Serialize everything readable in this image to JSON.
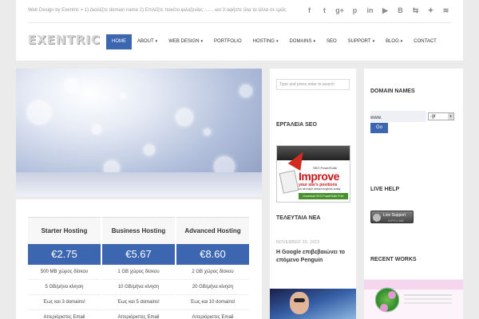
{
  "header": {
    "tagline": "Web Design by Exentric = 1) Διαλέξτε domain name 2) Επιλέξτε πακέτο φιλοξενίας ....... και 3 αφήστε όλα τα άλλα σε εμάς",
    "logo": "EXENTRIC",
    "social_icons": [
      "facebook-icon",
      "twitter-icon",
      "google-plus-icon",
      "pinterest-icon",
      "linkedin-icon",
      "youtube-icon",
      "blogger-icon",
      "share-icon",
      "delicious-icon",
      "rss-icon"
    ],
    "social_glyphs": [
      "f",
      "t",
      "g+",
      "p",
      "in",
      "▶",
      "B",
      "⇆",
      "✦",
      "≋"
    ]
  },
  "nav": {
    "items": [
      {
        "label": "HOME",
        "active": true,
        "has_caret": false
      },
      {
        "label": "ABOUT",
        "caret": "▾"
      },
      {
        "label": "WEB DESIGN",
        "caret": "▾"
      },
      {
        "label": "PORTFOLIO"
      },
      {
        "label": "HOSTING",
        "caret": "▾"
      },
      {
        "label": "DOMAINS",
        "caret": "▾"
      },
      {
        "label": "SEO"
      },
      {
        "label": "SUPPORT",
        "caret": "▾"
      },
      {
        "label": "BLOG",
        "caret": "▾"
      },
      {
        "label": "CONTACT"
      }
    ]
  },
  "pricing": {
    "plans": [
      {
        "name": "Starter Hosting",
        "price": "€2.75",
        "features": [
          "500 MB χώρος δίσκου",
          "5 GB/μήνα κίνηση",
          "Έως και 3 domains!",
          "Απεριόριστες Email"
        ]
      },
      {
        "name": "Business Hosting",
        "price": "€5.67",
        "features": [
          "1 GB χώρος δίσκου",
          "10 GB/μήνα κίνηση",
          "Έως και 5 domains!",
          "Απεριόριστες Email"
        ]
      },
      {
        "name": "Advanced Hosting",
        "price": "€8.60",
        "features": [
          "2 GB χώρος δίσκου",
          "20 GB/μήνα κίνηση",
          "Έως και 10 domains!",
          "Απεριόριστες Email"
        ]
      }
    ]
  },
  "middle": {
    "search_placeholder": "Type and press enter to search",
    "seo_heading": "ΕΡΓΑΛΕΙΑ SEO",
    "ad": {
      "brand": "SEO PowerSuite",
      "headline": "Improve",
      "sub": "your site's positions",
      "sub2": "on all major search engines today",
      "button": "Download SEO PowerSuite Free"
    },
    "news_heading": "ΤΕΛΕΥΤΑΙΑ ΝΕΑ",
    "post": {
      "date": "NOVEMBER 30, 2015",
      "title": "Η Google επιβεβαιώνει το επόμενο Penguin"
    }
  },
  "right": {
    "domain_heading": "DOMAIN NAMES",
    "www_label": "www.",
    "tld": ".gr",
    "go_label": "Go",
    "live_heading": "LIVE HELP",
    "live_button": {
      "line1": "Live Support",
      "line2": "OFFLINE"
    },
    "works_heading": "RECENT WORKS"
  },
  "colors": {
    "accent": "#3d66b1",
    "background": "#ebebeb"
  }
}
